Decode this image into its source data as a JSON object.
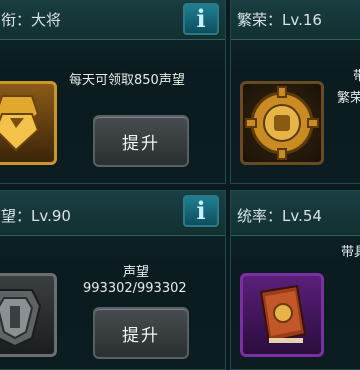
{
  "panels": {
    "top_left": {
      "title": "衔：大将",
      "info_icon": "i",
      "description": "每天可领取850声望",
      "button_label": "提升",
      "icon": "rank-badge-icon"
    },
    "top_right": {
      "title": "繁荣：Lv.16",
      "side_text_1": "带",
      "side_text_2": "繁荣",
      "icon": "gear-fist-icon"
    },
    "bottom_left": {
      "title": "望：Lv.90",
      "info_icon": "i",
      "label": "声望",
      "progress": "993302/993302",
      "button_label": "提升",
      "icon": "shield-emblem-icon"
    },
    "bottom_right": {
      "title": "统率：Lv.54",
      "side_text": "带具",
      "icon": "book-icon"
    }
  },
  "colors": {
    "background": "#0b1a1e",
    "info_button": "#1f7f93",
    "frame_gold": "#c8962b",
    "frame_purple": "#7a2fa3"
  }
}
